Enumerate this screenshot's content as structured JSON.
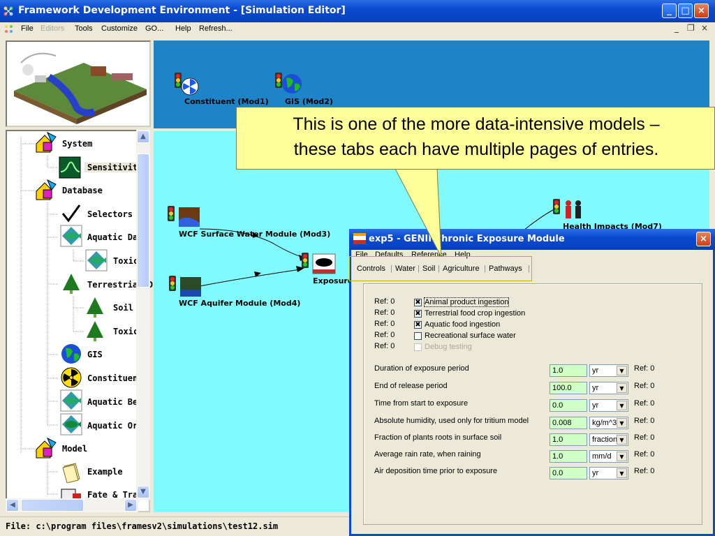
{
  "main_window": {
    "title": "Framework Development Environment - [Simulation Editor]",
    "menu": [
      "File",
      "Editors",
      "Tools",
      "Customize",
      "GO...",
      "Help",
      "Refresh..."
    ],
    "mdi_controls": [
      "_",
      "❐",
      "×"
    ],
    "title_buttons": [
      "_",
      "□",
      "×"
    ]
  },
  "tree": {
    "items": [
      {
        "label": "System",
        "icon": "system-shapes-icon"
      },
      {
        "label": "Sensitivity",
        "icon": "sensitivity-graph-icon"
      },
      {
        "label": "Database",
        "icon": "database-shapes-icon"
      },
      {
        "label": "Selectors",
        "icon": "checkmark-icon"
      },
      {
        "label": "Aquatic Dat",
        "icon": "fish-icon"
      },
      {
        "label": "Toxic",
        "icon": "fish-icon"
      },
      {
        "label": "Terrestrial D",
        "icon": "tree-icon"
      },
      {
        "label": "Soil S",
        "icon": "tree-icon"
      },
      {
        "label": "Toxic",
        "icon": "tree-icon"
      },
      {
        "label": "GIS",
        "icon": "globe-icon"
      },
      {
        "label": "Constituent",
        "icon": "radiation-icon"
      },
      {
        "label": "Aquatic Ber",
        "icon": "fish-icon"
      },
      {
        "label": "Aquatic Org",
        "icon": "fish-icon"
      },
      {
        "label": "Model",
        "icon": "model-shapes-icon"
      },
      {
        "label": "Example",
        "icon": "folder-icon"
      },
      {
        "label": "Fate & Tran",
        "icon": "computer-icon"
      }
    ]
  },
  "modules": {
    "constituent": "Constituent (Mod1)",
    "gis": "GIS (Mod2)",
    "surface_water": "WCF Surface Water Module (Mod3)",
    "aquifer": "WCF Aquifer Module (Mod4)",
    "exposure": "Exposure",
    "health": "Health Impacts (Mod7)"
  },
  "callout": {
    "line1": "This is one of the more data-intensive models –",
    "line2": "these tabs each have multiple pages of entries."
  },
  "status": "File: c:\\program files\\framesv2\\simulations\\test12.sim",
  "dialog": {
    "title": "exp5 - GENII Chronic Exposure Module",
    "menu": [
      "File",
      "Defaults",
      "Reference",
      "Help"
    ],
    "tabs": [
      "Controls",
      "Water",
      "Soil",
      "Agriculture",
      "Pathways"
    ],
    "checks": [
      {
        "ref": "Ref: 0",
        "label": "Animal product ingestion",
        "checked": "✖",
        "disabled": false
      },
      {
        "ref": "Ref: 0",
        "label": "Terrestrial food crop ingestion",
        "checked": "✖",
        "disabled": false
      },
      {
        "ref": "Ref: 0",
        "label": "Aquatic food ingestion",
        "checked": "✖",
        "disabled": false
      },
      {
        "ref": "Ref: 0",
        "label": "Recreational surface water",
        "checked": "",
        "disabled": false
      },
      {
        "ref": "Ref: 0",
        "label": "Debug testing",
        "checked": "",
        "disabled": true
      }
    ],
    "params": [
      {
        "label": "Duration of exposure period",
        "value": "1.0",
        "unit": "yr",
        "ref": "Ref:  0"
      },
      {
        "label": "End of release period",
        "value": "100.0",
        "unit": "yr",
        "ref": "Ref:  0"
      },
      {
        "label": "Time from start to exposure",
        "value": "0.0",
        "unit": "yr",
        "ref": "Ref:  0"
      },
      {
        "label": "Absolute humidity, used only for tritium model",
        "value": "0.008",
        "unit": "kg/m^3",
        "ref": "Ref:  0"
      },
      {
        "label": "Fraction of plants roots in surface soil",
        "value": "1.0",
        "unit": "fraction",
        "ref": "Ref:  0"
      },
      {
        "label": "Average rain rate, when raining",
        "value": "1.0",
        "unit": "mm/d",
        "ref": "Ref:  0"
      },
      {
        "label": "Air deposition time prior to exposure",
        "value": "0.0",
        "unit": "yr",
        "ref": "Ref:  0"
      }
    ]
  },
  "colors": {
    "titlebar": "#0a4ad0",
    "top_canvas": "#1d84c8",
    "canvas": "#80fafc",
    "callout": "#ffff99",
    "input_fill": "#d0ffc8"
  }
}
